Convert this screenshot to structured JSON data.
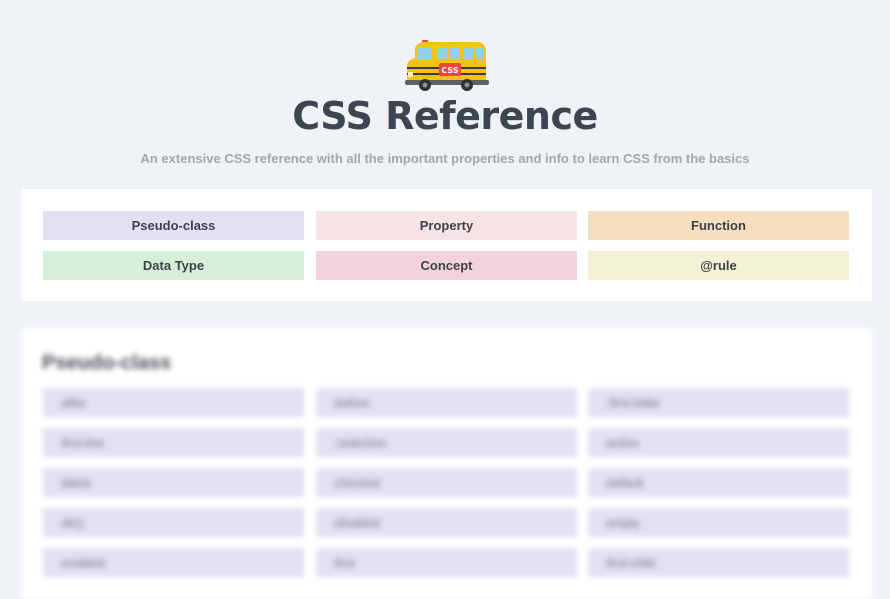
{
  "header": {
    "logo_icon": "school-bus-icon",
    "logo_badge": "CSS",
    "title": "CSS Reference",
    "subtitle": "An extensive CSS reference with all the important properties and info to learn CSS from the basics"
  },
  "legend": {
    "items": [
      {
        "label": "Pseudo-class",
        "color": "#e3e0f1"
      },
      {
        "label": "Property",
        "color": "#f5e3e5"
      },
      {
        "label": "Function",
        "color": "#f5dfbf"
      },
      {
        "label": "Data Type",
        "color": "#d5efd8"
      },
      {
        "label": "Concept",
        "color": "#f2d3dc"
      },
      {
        "label": "@rule",
        "color": "#f3f2d7"
      }
    ]
  },
  "section": {
    "title": "Pseudo-class",
    "items": [
      ":after",
      ":before",
      "::first-letter",
      ":first-line",
      "::selection",
      ":active",
      ":blank",
      ":checked",
      ":default",
      ":dir()",
      ":disabled",
      ":empty",
      ":enabled",
      ":first",
      ":first-child"
    ]
  }
}
